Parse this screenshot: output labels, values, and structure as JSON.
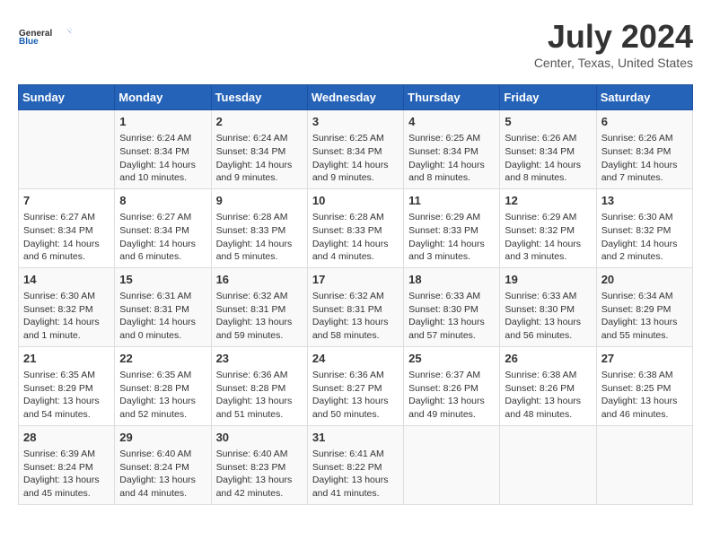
{
  "header": {
    "logo_line1": "General",
    "logo_line2": "Blue",
    "month_year": "July 2024",
    "location": "Center, Texas, United States"
  },
  "weekdays": [
    "Sunday",
    "Monday",
    "Tuesday",
    "Wednesday",
    "Thursday",
    "Friday",
    "Saturday"
  ],
  "weeks": [
    [
      {
        "day": "",
        "content": ""
      },
      {
        "day": "1",
        "content": "Sunrise: 6:24 AM\nSunset: 8:34 PM\nDaylight: 14 hours\nand 10 minutes."
      },
      {
        "day": "2",
        "content": "Sunrise: 6:24 AM\nSunset: 8:34 PM\nDaylight: 14 hours\nand 9 minutes."
      },
      {
        "day": "3",
        "content": "Sunrise: 6:25 AM\nSunset: 8:34 PM\nDaylight: 14 hours\nand 9 minutes."
      },
      {
        "day": "4",
        "content": "Sunrise: 6:25 AM\nSunset: 8:34 PM\nDaylight: 14 hours\nand 8 minutes."
      },
      {
        "day": "5",
        "content": "Sunrise: 6:26 AM\nSunset: 8:34 PM\nDaylight: 14 hours\nand 8 minutes."
      },
      {
        "day": "6",
        "content": "Sunrise: 6:26 AM\nSunset: 8:34 PM\nDaylight: 14 hours\nand 7 minutes."
      }
    ],
    [
      {
        "day": "7",
        "content": "Sunrise: 6:27 AM\nSunset: 8:34 PM\nDaylight: 14 hours\nand 6 minutes."
      },
      {
        "day": "8",
        "content": "Sunrise: 6:27 AM\nSunset: 8:34 PM\nDaylight: 14 hours\nand 6 minutes."
      },
      {
        "day": "9",
        "content": "Sunrise: 6:28 AM\nSunset: 8:33 PM\nDaylight: 14 hours\nand 5 minutes."
      },
      {
        "day": "10",
        "content": "Sunrise: 6:28 AM\nSunset: 8:33 PM\nDaylight: 14 hours\nand 4 minutes."
      },
      {
        "day": "11",
        "content": "Sunrise: 6:29 AM\nSunset: 8:33 PM\nDaylight: 14 hours\nand 3 minutes."
      },
      {
        "day": "12",
        "content": "Sunrise: 6:29 AM\nSunset: 8:32 PM\nDaylight: 14 hours\nand 3 minutes."
      },
      {
        "day": "13",
        "content": "Sunrise: 6:30 AM\nSunset: 8:32 PM\nDaylight: 14 hours\nand 2 minutes."
      }
    ],
    [
      {
        "day": "14",
        "content": "Sunrise: 6:30 AM\nSunset: 8:32 PM\nDaylight: 14 hours\nand 1 minute."
      },
      {
        "day": "15",
        "content": "Sunrise: 6:31 AM\nSunset: 8:31 PM\nDaylight: 14 hours\nand 0 minutes."
      },
      {
        "day": "16",
        "content": "Sunrise: 6:32 AM\nSunset: 8:31 PM\nDaylight: 13 hours\nand 59 minutes."
      },
      {
        "day": "17",
        "content": "Sunrise: 6:32 AM\nSunset: 8:31 PM\nDaylight: 13 hours\nand 58 minutes."
      },
      {
        "day": "18",
        "content": "Sunrise: 6:33 AM\nSunset: 8:30 PM\nDaylight: 13 hours\nand 57 minutes."
      },
      {
        "day": "19",
        "content": "Sunrise: 6:33 AM\nSunset: 8:30 PM\nDaylight: 13 hours\nand 56 minutes."
      },
      {
        "day": "20",
        "content": "Sunrise: 6:34 AM\nSunset: 8:29 PM\nDaylight: 13 hours\nand 55 minutes."
      }
    ],
    [
      {
        "day": "21",
        "content": "Sunrise: 6:35 AM\nSunset: 8:29 PM\nDaylight: 13 hours\nand 54 minutes."
      },
      {
        "day": "22",
        "content": "Sunrise: 6:35 AM\nSunset: 8:28 PM\nDaylight: 13 hours\nand 52 minutes."
      },
      {
        "day": "23",
        "content": "Sunrise: 6:36 AM\nSunset: 8:28 PM\nDaylight: 13 hours\nand 51 minutes."
      },
      {
        "day": "24",
        "content": "Sunrise: 6:36 AM\nSunset: 8:27 PM\nDaylight: 13 hours\nand 50 minutes."
      },
      {
        "day": "25",
        "content": "Sunrise: 6:37 AM\nSunset: 8:26 PM\nDaylight: 13 hours\nand 49 minutes."
      },
      {
        "day": "26",
        "content": "Sunrise: 6:38 AM\nSunset: 8:26 PM\nDaylight: 13 hours\nand 48 minutes."
      },
      {
        "day": "27",
        "content": "Sunrise: 6:38 AM\nSunset: 8:25 PM\nDaylight: 13 hours\nand 46 minutes."
      }
    ],
    [
      {
        "day": "28",
        "content": "Sunrise: 6:39 AM\nSunset: 8:24 PM\nDaylight: 13 hours\nand 45 minutes."
      },
      {
        "day": "29",
        "content": "Sunrise: 6:40 AM\nSunset: 8:24 PM\nDaylight: 13 hours\nand 44 minutes."
      },
      {
        "day": "30",
        "content": "Sunrise: 6:40 AM\nSunset: 8:23 PM\nDaylight: 13 hours\nand 42 minutes."
      },
      {
        "day": "31",
        "content": "Sunrise: 6:41 AM\nSunset: 8:22 PM\nDaylight: 13 hours\nand 41 minutes."
      },
      {
        "day": "",
        "content": ""
      },
      {
        "day": "",
        "content": ""
      },
      {
        "day": "",
        "content": ""
      }
    ]
  ]
}
